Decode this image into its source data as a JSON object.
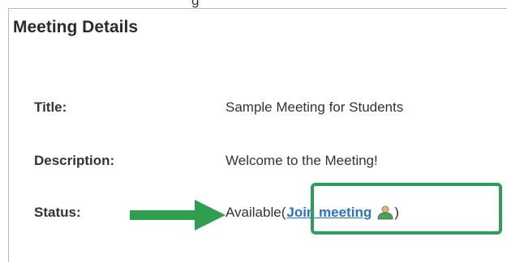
{
  "top_cut_text": "g",
  "panel": {
    "title": "Meeting Details"
  },
  "details": {
    "title_label": "Title:",
    "title_value": "Sample Meeting for Students",
    "description_label": "Description:",
    "description_value": "Welcome to the Meeting!",
    "status_label": "Status:",
    "status_value": "Available",
    "status_open_paren": "(",
    "join_link_label": "Join meeting",
    "status_close_paren": ")"
  },
  "colors": {
    "highlight_green": "#2c9e5c",
    "arrow_green": "#2f9e4f",
    "link_blue": "#2a73c8"
  },
  "icons": {
    "arrow": "right-arrow-icon",
    "join": "user-icon"
  }
}
